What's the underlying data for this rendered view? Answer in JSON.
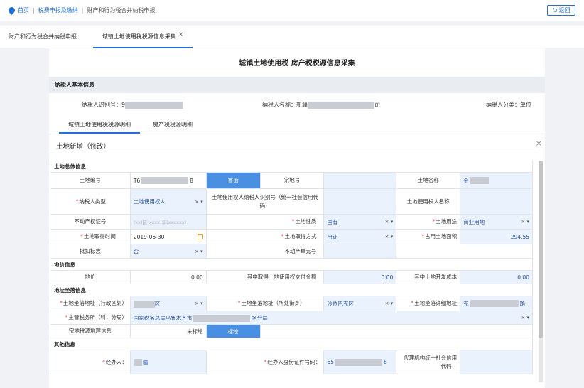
{
  "breadcrumb": {
    "home": "首页",
    "level2": "税费申报及缴纳",
    "current": "财产和行为税合并纳税申报",
    "back_label": "返回"
  },
  "tabs": [
    {
      "label": "财产和行为税合并纳税申报"
    },
    {
      "label": "城镇土地使用税税源信息采集",
      "close": "×"
    }
  ],
  "page_title": "城镇土地使用税  房产税税源信息采集",
  "basic": {
    "section": "纳税人基本信息",
    "id_label": "纳税人识别号：",
    "id_prefix": "9",
    "name_label": "纳税人名称：",
    "name_prefix": "新疆",
    "name_suffix": "司",
    "type_label": "纳税人分类：",
    "type_value": "单位"
  },
  "subtabs": [
    "城镇土地使用税税源明细",
    "房产税税源明细"
  ],
  "edit": {
    "title": "土地新增（修改）",
    "close": "×"
  },
  "groups": {
    "land": "土地总体信息",
    "price": "地价信息",
    "address": "地址坐落信息",
    "other": "其他信息"
  },
  "land": {
    "land_no_label": "土地编号",
    "land_no_prefix": "T6",
    "land_no_suffix": "8",
    "query_btn": "查询",
    "parcel_no_label": "宗地号",
    "land_name_label": "土地名称",
    "land_name_prefix": "金",
    "taxpayer_type_label": "纳税人类型",
    "taxpayer_type_value": "土地使用权人",
    "user_id_label": "土地使用权人纳税人识别号（统一社会信用代码）",
    "user_name_label": "土地使用权人名称",
    "cert_label": "不动产权证号",
    "cert_placeholder": "(xx)区(xxxx)年(xxxxxx)",
    "nature_label": "土地性质",
    "nature_value": "国有",
    "use_label": "土地用途",
    "use_value": "商业用地",
    "acq_time_label": "土地取得时间",
    "acq_time_value": "2019-06-30",
    "acq_way_label": "土地取得方式",
    "acq_way_value": "出让",
    "area_label": "占用土地面积",
    "area_value": "294.55",
    "approve_label": "批扣标志",
    "approve_value": "否",
    "unit_no_label": "不动产单元号"
  },
  "price": {
    "price_label": "地价",
    "price_value": "0.00",
    "fee_label": "其中取得土地使用权支付金额",
    "fee_value": "0.00",
    "dev_label": "其中土地开发成本",
    "dev_value": "0.00"
  },
  "address": {
    "district_label": "土地坐落地址（行政区划）",
    "district_suffix": "区",
    "street_label": "土地坐落地址（所处街乡）",
    "street_value": "沙依巴克区",
    "detail_label": "土地坐落详细地址",
    "detail_prefix": "克",
    "detail_suffix": "路",
    "office_label": "主管税务所（科，分局）",
    "office_prefix": "国家税务总局乌鲁木齐市",
    "office_suffix": "务分局",
    "geo_label": "宗地税源地理信息",
    "geo_value": "未标绘",
    "mark_btn": "标绘"
  },
  "other": {
    "agent_label": "经办人：",
    "agent_suffix": "疆",
    "agent_id_label": "经办人身份证件号码：",
    "agent_id_prefix": "65",
    "agent_id_suffix": "8",
    "org_label": "代理机构统一社会信用代码："
  },
  "controls": {
    "clear": "×",
    "arrow": "▾"
  }
}
